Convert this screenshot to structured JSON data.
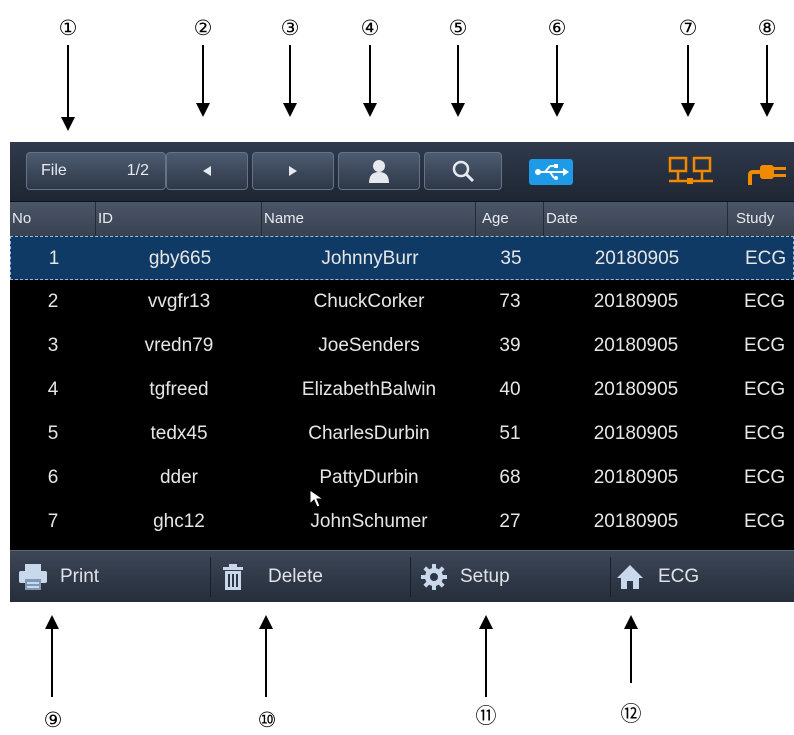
{
  "callouts": {
    "top": [
      "①",
      "②",
      "③",
      "④",
      "⑤",
      "⑥",
      "⑦",
      "⑧"
    ],
    "bottom": [
      "⑨",
      "⑩",
      "⑪",
      "⑫"
    ]
  },
  "toolbar": {
    "file_label": "File",
    "page_indicator": "1/2",
    "prev_icon": "triangle-left-icon",
    "next_icon": "triangle-right-icon",
    "patient_icon": "person-icon",
    "search_icon": "magnifier-icon",
    "usb_icon": "usb-icon",
    "network_icon": "network-icon",
    "power_icon": "power-plug-icon",
    "usb_color": "#1e9be6",
    "network_color": "#f28a00",
    "power_color": "#f28a00"
  },
  "table": {
    "columns": [
      "No",
      "ID",
      "Name",
      "Age",
      "Date",
      "Study"
    ],
    "rows": [
      {
        "no": "1",
        "id": "gby665",
        "name": "JohnnyBurr",
        "age": "35",
        "date": "20180905",
        "study": "ECG",
        "selected": true
      },
      {
        "no": "2",
        "id": "vvgfr13",
        "name": "ChuckCorker",
        "age": "73",
        "date": "20180905",
        "study": "ECG"
      },
      {
        "no": "3",
        "id": "vredn79",
        "name": "JoeSenders",
        "age": "39",
        "date": "20180905",
        "study": "ECG"
      },
      {
        "no": "4",
        "id": "tgfreed",
        "name": "ElizabethBalwin",
        "age": "40",
        "date": "20180905",
        "study": "ECG"
      },
      {
        "no": "5",
        "id": "tedx45",
        "name": "CharlesDurbin",
        "age": "51",
        "date": "20180905",
        "study": "ECG"
      },
      {
        "no": "6",
        "id": "dder",
        "name": "PattyDurbin",
        "age": "68",
        "date": "20180905",
        "study": "ECG"
      },
      {
        "no": "7",
        "id": "ghc12",
        "name": "JohnSchumer",
        "age": "27",
        "date": "20180905",
        "study": "ECG"
      }
    ]
  },
  "bottombar": {
    "print_label": "Print",
    "delete_label": "Delete",
    "setup_label": "Setup",
    "ecg_label": "ECG",
    "print_icon": "printer-icon",
    "delete_icon": "trash-icon",
    "setup_icon": "gear-icon",
    "ecg_icon": "home-icon"
  },
  "colors": {
    "selected_row": "#0f3a66",
    "screen_bg": "#000000",
    "toolbar_bg": "#2a3444"
  }
}
